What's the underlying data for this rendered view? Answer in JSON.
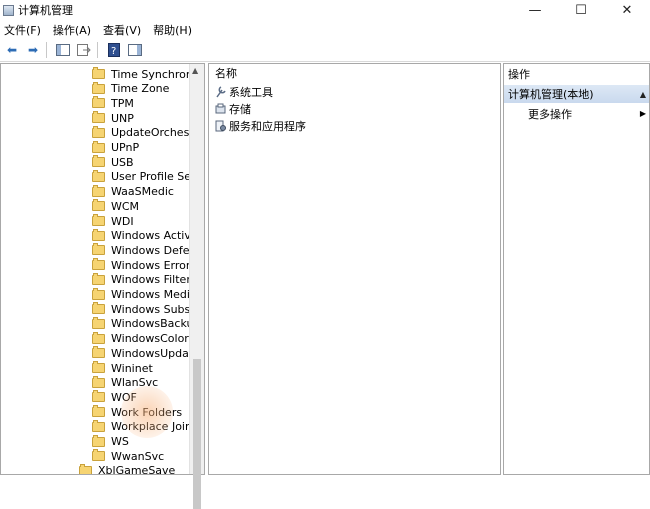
{
  "window": {
    "title": "计算机管理"
  },
  "menu": [
    "文件(F)",
    "操作(A)",
    "查看(V)",
    "帮助(H)"
  ],
  "tree": {
    "items": [
      "Time Synchronizat",
      "Time Zone",
      "TPM",
      "UNP",
      "UpdateOrchestrato",
      "UPnP",
      "USB",
      "User Profile Servic",
      "WaaSMedic",
      "WCM",
      "WDI",
      "Windows Activatio",
      "Windows Defende",
      "Windows Error Rep",
      "Windows Filtering",
      "Windows Media Sl",
      "Windows Subsyste",
      "WindowsBackup",
      "WindowsColorSyst",
      "WindowsUpdate",
      "Wininet",
      "WlanSvc",
      "WOF",
      "Work Folders",
      "Workplace Join",
      "WS",
      "WwanSvc",
      "XblGameSave"
    ]
  },
  "center": {
    "column_header": "名称",
    "items": [
      "系统工具",
      "存储",
      "服务和应用程序"
    ]
  },
  "actions": {
    "header": "操作",
    "section": "计算机管理(本地)",
    "more": "更多操作"
  }
}
